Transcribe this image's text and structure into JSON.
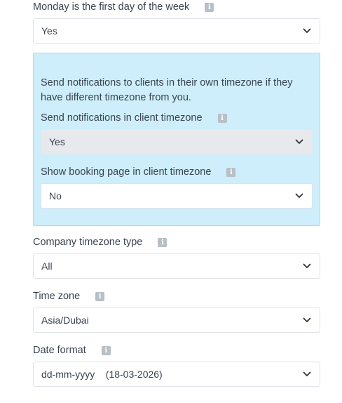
{
  "fields": {
    "first_day": {
      "label": "Monday is the first day of the week",
      "value": "Yes"
    },
    "client_tz": {
      "notice": "Send notifications to clients in their own timezone if they have different timezone from you.",
      "notifications": {
        "label": "Send notifications in client timezone",
        "value": "Yes"
      },
      "booking_page": {
        "label": "Show booking page in client timezone",
        "value": "No"
      }
    },
    "company_tz_type": {
      "label": "Company timezone type",
      "value": "All"
    },
    "time_zone": {
      "label": "Time zone",
      "value": "Asia/Dubai"
    },
    "date_format": {
      "label": "Date format",
      "value": "dd-mm-yyyy    (18-03-2026)"
    }
  },
  "icons": {
    "info": "info-icon",
    "chevron": "chevron-down-icon"
  },
  "info_glyph": "i",
  "colors": {
    "panel_bg": "#cdeefa",
    "panel_border": "#a9dcee",
    "info_icon_bg": "#b8bfc6",
    "disabled_select_bg": "#e7e9ec"
  }
}
